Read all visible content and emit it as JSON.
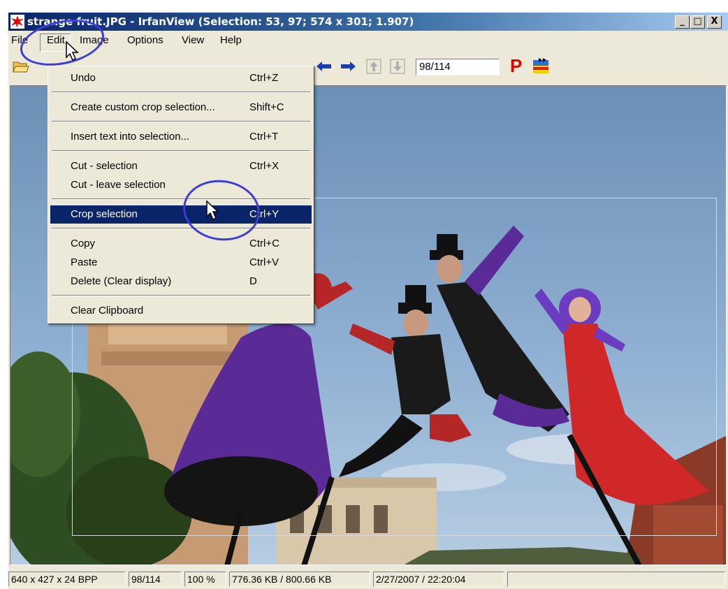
{
  "window": {
    "title": "strange fruit.JPG - IrfanView (Selection: 53, 97; 574 x 301; 1.907)",
    "minimize_glyph": "_",
    "maximize_glyph": "□",
    "close_glyph": "X"
  },
  "menubar": {
    "file": "File",
    "edit": "Edit",
    "image": "Image",
    "options": "Options",
    "view": "View",
    "help": "Help"
  },
  "toolbar": {
    "icons": [
      "open-folder-icon",
      "prev-arrow-icon",
      "next-arrow-icon",
      "up-icon",
      "down-icon",
      "paint-icon",
      "iv-logo-icon"
    ],
    "counter": "98/114",
    "paint_label": "P"
  },
  "edit_menu": {
    "items": [
      {
        "label": "Undo",
        "shortcut": "Ctrl+Z"
      },
      {
        "label": "Create custom crop selection...",
        "shortcut": "Shift+C"
      },
      {
        "label": "Insert text into selection...",
        "shortcut": "Ctrl+T"
      },
      {
        "label": "Cut - selection",
        "shortcut": "Ctrl+X"
      },
      {
        "label": "Cut - leave selection",
        "shortcut": ""
      },
      {
        "label": "Crop selection",
        "shortcut": "Ctrl+Y"
      },
      {
        "label": "Copy",
        "shortcut": "Ctrl+C"
      },
      {
        "label": "Paste",
        "shortcut": "Ctrl+V"
      },
      {
        "label": "Delete (Clear display)",
        "shortcut": "D"
      },
      {
        "label": "Clear Clipboard",
        "shortcut": ""
      }
    ]
  },
  "statusbar": {
    "dimensions": "640 x 427 x 24 BPP",
    "index": "98/114",
    "zoom": "100 %",
    "filesize": "776.36 KB / 800.66 KB",
    "datetime": "2/27/2007 / 22:20:04"
  },
  "colors": {
    "title_start": "#0a246a",
    "title_end": "#a6caf0",
    "highlight": "#0a246a",
    "annotation_circle": "#3d3dd9",
    "paint_red": "#e00000"
  }
}
